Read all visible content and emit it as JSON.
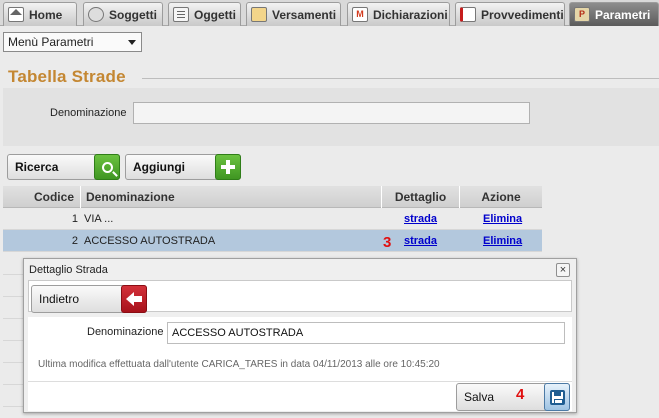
{
  "tabs": [
    {
      "label": "Home",
      "icon": "home-icon"
    },
    {
      "label": "Soggetti",
      "icon": "user-icon"
    },
    {
      "label": "Oggetti",
      "icon": "building-icon"
    },
    {
      "label": "Versamenti",
      "icon": "payment-icon"
    },
    {
      "label": "Dichiarazioni",
      "icon": "declaration-icon"
    },
    {
      "label": "Provvedimenti",
      "icon": "document-icon"
    },
    {
      "label": "Parametri",
      "icon": "parameters-icon",
      "active": true
    }
  ],
  "menu": {
    "selected": "Menù Parametri"
  },
  "page": {
    "title": "Tabella Strade"
  },
  "filter": {
    "label": "Denominazione",
    "value": ""
  },
  "actions": {
    "search_label": "Ricerca",
    "add_label": "Aggiungi"
  },
  "table": {
    "headers": {
      "code": "Codice",
      "name": "Denominazione",
      "detail": "Dettaglio",
      "action": "Azione"
    },
    "rows": [
      {
        "code": "1",
        "name": "VIA ...",
        "detail": "strada",
        "action": "Elimina"
      },
      {
        "code": "2",
        "name": "ACCESSO AUTOSTRADA",
        "detail": "strada",
        "action": "Elimina",
        "selected": true
      }
    ]
  },
  "dialog": {
    "title": "Dettaglio Strada",
    "close": "×",
    "back_label": "Indietro",
    "field_label": "Denominazione",
    "field_value": "ACCESSO AUTOSTRADA",
    "note": "Ultima modifica effettuata dall'utente CARICA_TARES in data 04/11/2013 alle ore 10:45:20",
    "save_label": "Salva"
  },
  "annotations": {
    "marker3": "3",
    "marker4": "4"
  },
  "colors": {
    "accent": "#c48732",
    "selected_row": "#b3c8dd",
    "link": "#0000cc",
    "marker": "#e01010"
  }
}
